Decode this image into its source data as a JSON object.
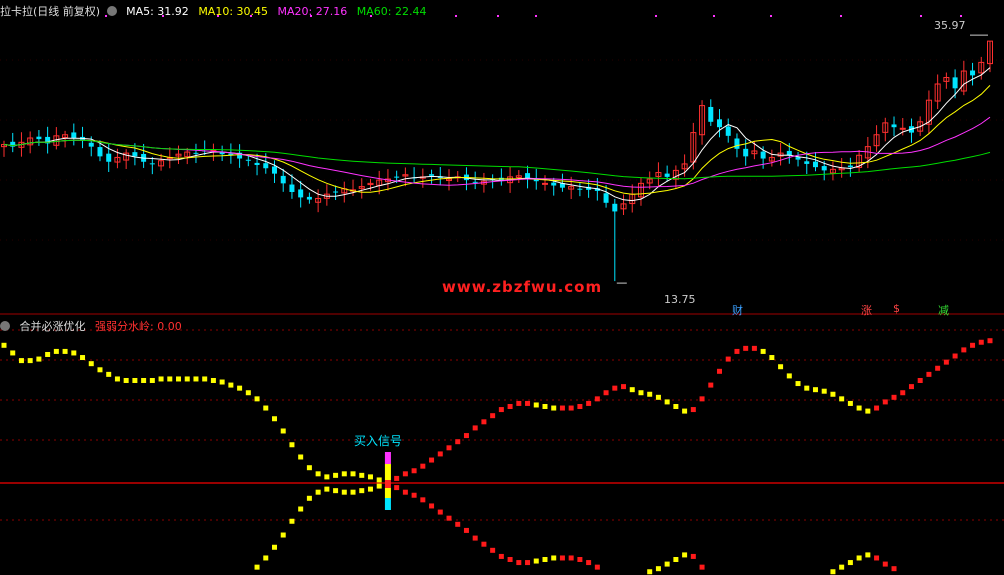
{
  "window": {
    "title": "拉卡拉(日线 前复权)"
  },
  "price_panel": {
    "ma_legend": [
      {
        "label": "MA5: 31.92",
        "color": "#ffffff"
      },
      {
        "label": "MA10: 30.45",
        "color": "#ffff00"
      },
      {
        "label": "MA20: 27.16",
        "color": "#ff33ff"
      },
      {
        "label": "MA60: 22.44",
        "color": "#00dd00"
      }
    ],
    "high_label": "35.97",
    "low_label": "13.75",
    "watermark": "www.zbzfwu.com",
    "event_tags": [
      {
        "text": "财",
        "color": "#3aa0ff"
      },
      {
        "text": "涨",
        "color": "#ff4444"
      },
      {
        "text": "$",
        "color": "#ff4444"
      },
      {
        "text": "减",
        "color": "#33dd33"
      }
    ]
  },
  "indicator_panel": {
    "title": "合并必涨优化",
    "param": "强弱分水岭: 0.00",
    "signal_label": "买入信号"
  },
  "colors": {
    "up": "#ff3030",
    "down": "#00e5ff",
    "grid": "#8b0000",
    "bull": "#ff1a1a",
    "bear": "#ffff00",
    "watermark": "#ff2020"
  },
  "chart_data": [
    {
      "type": "candlestick",
      "title": "拉卡拉(日线 前复权)",
      "ylim": [
        12.0,
        37.0
      ],
      "close_series": [
        26.4,
        26.2,
        26.6,
        27.0,
        26.9,
        26.5,
        27.2,
        27.3,
        27.0,
        26.8,
        26.2,
        25.3,
        24.8,
        25.2,
        25.6,
        25.3,
        24.8,
        24.6,
        24.9,
        25.2,
        25.5,
        25.7,
        25.6,
        25.8,
        25.9,
        25.5,
        25.4,
        25.1,
        24.9,
        24.5,
        24.2,
        23.7,
        22.8,
        22.0,
        21.5,
        21.3,
        21.4,
        21.8,
        22.0,
        22.3,
        22.2,
        22.5,
        22.8,
        23.1,
        23.2,
        23.4,
        23.6,
        23.3,
        23.4,
        23.5,
        23.3,
        23.2,
        23.4,
        23.1,
        22.9,
        23.0,
        23.2,
        23.1,
        23.4,
        23.5,
        23.2,
        23.0,
        22.8,
        22.6,
        22.4,
        22.5,
        22.3,
        22.2,
        22.1,
        21.0,
        20.2,
        20.9,
        21.8,
        22.8,
        23.2,
        23.8,
        23.4,
        24.0,
        24.6,
        27.5,
        30.0,
        28.5,
        28.0,
        27.2,
        26.0,
        25.3,
        25.8,
        25.1,
        25.2,
        25.6,
        25.4,
        25.0,
        24.6,
        24.3,
        24.0,
        24.1,
        24.2,
        24.3,
        25.4,
        26.2,
        27.3,
        28.4,
        28.0,
        27.9,
        27.5,
        28.5,
        30.5,
        32.0,
        32.6,
        31.6,
        33.2,
        32.8,
        34.0,
        35.97
      ],
      "low": 13.75,
      "high": 35.97,
      "moving_averages": [
        {
          "name": "MA5",
          "last": 31.92
        },
        {
          "name": "MA10",
          "last": 30.45
        },
        {
          "name": "MA20",
          "last": 27.16
        },
        {
          "name": "MA60",
          "last": 22.44
        }
      ]
    },
    {
      "type": "line",
      "title": "合并必涨优化",
      "threshold": 0.0,
      "bull_zero_index": 63,
      "upper_series": [
        0.9,
        0.85,
        0.8,
        0.8,
        0.81,
        0.84,
        0.86,
        0.86,
        0.85,
        0.82,
        0.78,
        0.74,
        0.71,
        0.68,
        0.67,
        0.67,
        0.67,
        0.67,
        0.68,
        0.68,
        0.68,
        0.68,
        0.68,
        0.68,
        0.67,
        0.66,
        0.64,
        0.62,
        0.59,
        0.55,
        0.49,
        0.42,
        0.34,
        0.25,
        0.17,
        0.1,
        0.06,
        0.04,
        0.05,
        0.06,
        0.06,
        0.05,
        0.04,
        0.02,
        0.0,
        0.03,
        0.06,
        0.08,
        0.11,
        0.15,
        0.19,
        0.23,
        0.27,
        0.31,
        0.36,
        0.4,
        0.44,
        0.48,
        0.5,
        0.52,
        0.52,
        0.51,
        0.5,
        0.49,
        0.49,
        0.49,
        0.5,
        0.52,
        0.55,
        0.59,
        0.62,
        0.63,
        0.61,
        0.59,
        0.58,
        0.56,
        0.53,
        0.5,
        0.47,
        0.48,
        0.55,
        0.64,
        0.73,
        0.81,
        0.86,
        0.88,
        0.88,
        0.86,
        0.82,
        0.76,
        0.7,
        0.65,
        0.62,
        0.61,
        0.6,
        0.58,
        0.55,
        0.52,
        0.49,
        0.47,
        0.49,
        0.53,
        0.56,
        0.59,
        0.63,
        0.67,
        0.71,
        0.75,
        0.79,
        0.83,
        0.87,
        0.9,
        0.92,
        0.93
      ]
    }
  ]
}
